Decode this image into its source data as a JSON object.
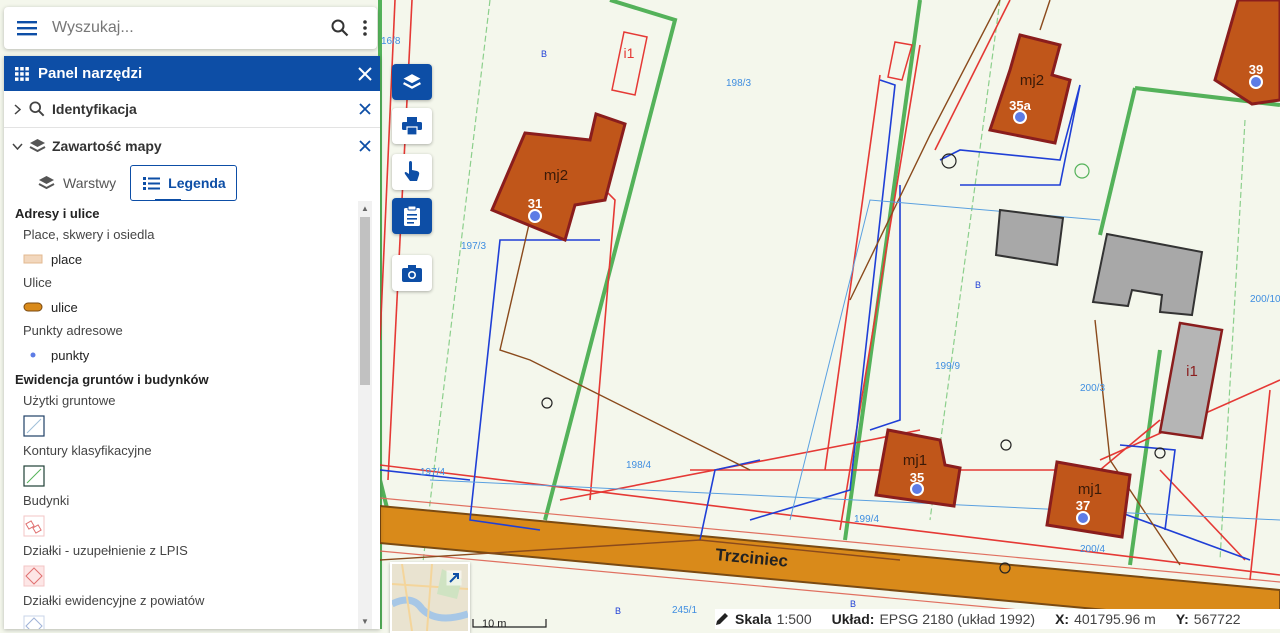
{
  "search": {
    "placeholder": "Wyszukaj..."
  },
  "panel": {
    "title": "Panel narzędzi",
    "sections": [
      {
        "label": "Identyfikacja"
      },
      {
        "label": "Zawartość mapy"
      }
    ],
    "tabs": [
      {
        "label": "Warstwy"
      },
      {
        "label": "Legenda"
      }
    ]
  },
  "legend": {
    "groups": [
      {
        "title": "Adresy i ulice",
        "layers": [
          {
            "name": "Place, skwery i osiedla",
            "item": "place"
          },
          {
            "name": "Ulice",
            "item": "ulice"
          },
          {
            "name": "Punkty adresowe",
            "item": "punkty"
          }
        ]
      },
      {
        "title": "Ewidencja gruntów i budynków",
        "layers": [
          {
            "name": "Użytki gruntowe"
          },
          {
            "name": "Kontury klasyfikacyjne"
          },
          {
            "name": "Budynki"
          },
          {
            "name": "Działki - uzupełnienie z LPIS"
          },
          {
            "name": "Działki ewidencyjne z powiatów"
          }
        ]
      }
    ]
  },
  "map": {
    "street_name": "Trzciniec",
    "buildings": [
      {
        "class": "mj2",
        "number": "31"
      },
      {
        "class": "mj2",
        "number": "35a"
      },
      {
        "class": "mj1",
        "number": "35"
      },
      {
        "class": "mj1",
        "number": "37"
      },
      {
        "class": "",
        "number": "39"
      }
    ],
    "inset_labels": [
      "i1",
      "i1"
    ],
    "small_markers": [
      "B",
      "B",
      "B",
      "B"
    ],
    "parcel_numbers": [
      "198/3",
      "197/3",
      "199/9",
      "200/3",
      "198/4",
      "199/4",
      "200/4",
      "197/4",
      "245/1",
      "200/10",
      "16/8"
    ]
  },
  "status": {
    "scale_label": "Skala",
    "scale_value": "1:500",
    "crs_label": "Układ:",
    "crs_value": "EPSG 2180 (układ 1992)",
    "x_label": "X:",
    "x_value": "401795.96 m",
    "y_label": "Y:",
    "y_value": "567722"
  },
  "scalebar": {
    "label": "10 m"
  },
  "colors": {
    "accent": "#0d4ea6",
    "building_residential": "#c0561a",
    "building_other": "#b5b5b5",
    "street": "#d98a1a",
    "map_background": "#f4f7ec"
  },
  "icons": {
    "menu": "hamburger-icon",
    "search": "search-icon",
    "more": "more-vertical-icon",
    "panel": "grid-icon",
    "close": "close-icon",
    "layers": "layers-icon",
    "print": "print-icon",
    "identify": "pointer-hand-icon",
    "clipboard": "clipboard-icon",
    "camera": "camera-icon",
    "expand": "expand-icon"
  }
}
